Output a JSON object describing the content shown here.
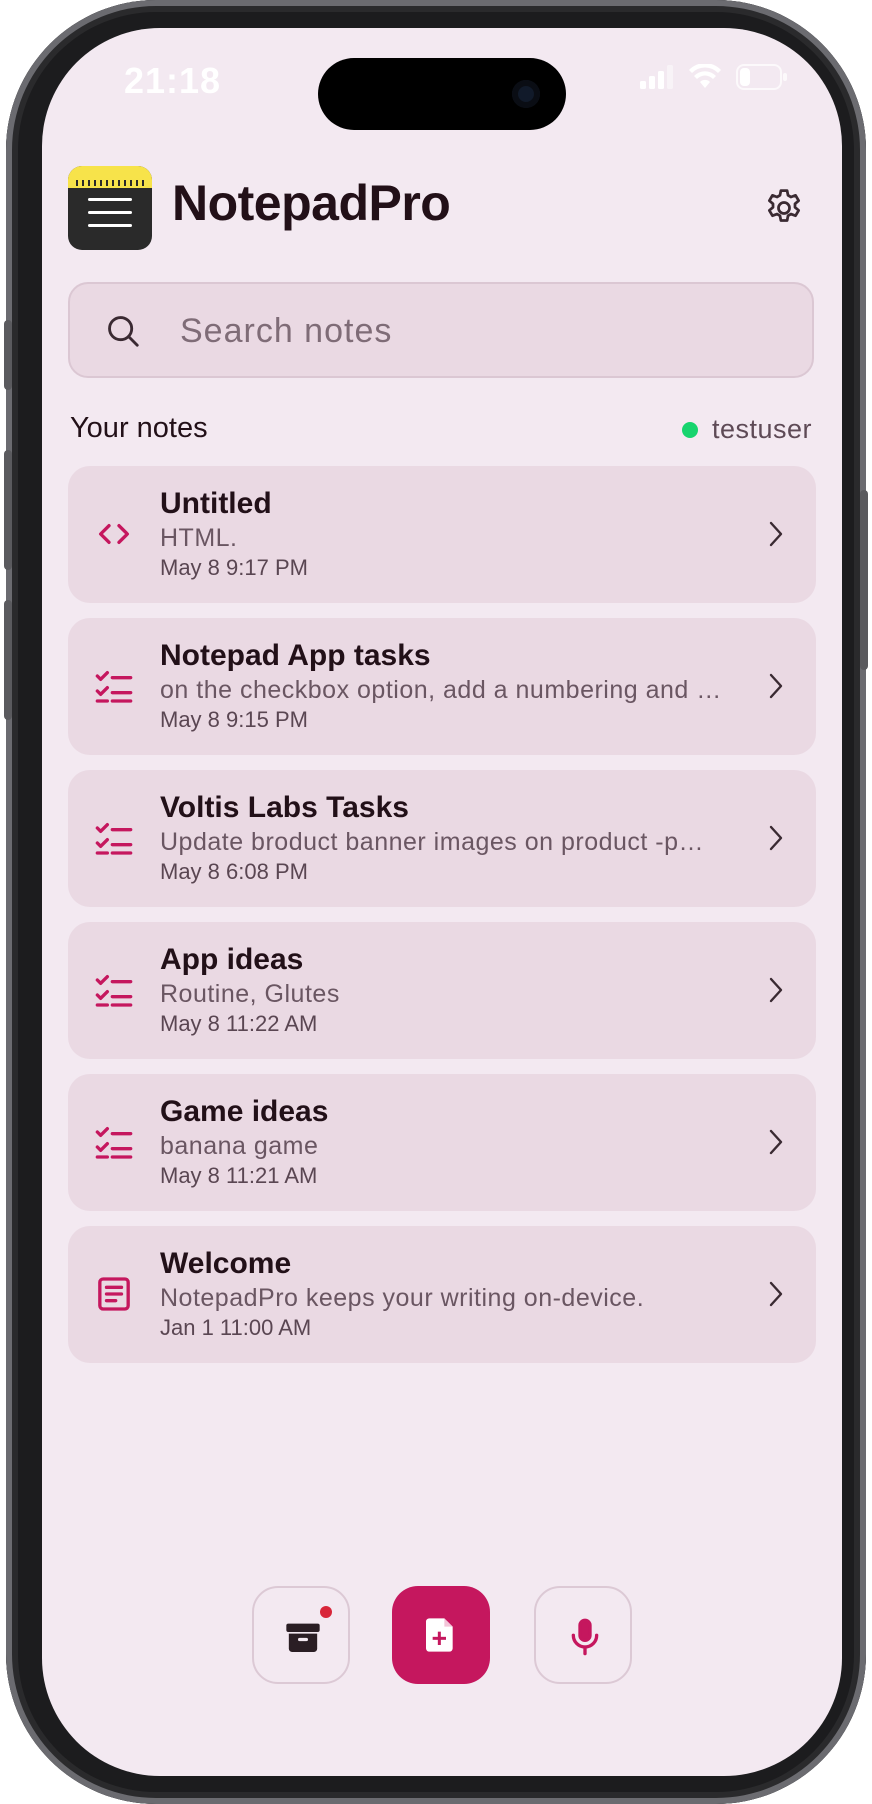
{
  "status_bar": {
    "time": "21:18"
  },
  "app": {
    "title": "NotepadPro"
  },
  "search": {
    "placeholder": "Search notes"
  },
  "section": {
    "title": "Your notes",
    "username": "testuser"
  },
  "notes": [
    {
      "title": "Untitled",
      "preview": "HTML.",
      "date": "May 8 9:17 PM",
      "icon": "code-icon"
    },
    {
      "title": "Notepad App tasks",
      "preview": "on the checkbox option, add a numbering and …",
      "date": "May 8 9:15 PM",
      "icon": "checklist-icon"
    },
    {
      "title": "Voltis Labs Tasks",
      "preview": "Update broduct banner images on product -p…",
      "date": "May 8 6:08 PM",
      "icon": "checklist-icon"
    },
    {
      "title": "App ideas",
      "preview": "Routine, Glutes",
      "date": "May 8 11:22 AM",
      "icon": "checklist-icon"
    },
    {
      "title": "Game ideas",
      "preview": "banana game",
      "date": "May 8 11:21 AM",
      "icon": "checklist-icon"
    },
    {
      "title": "Welcome",
      "preview": "NotepadPro keeps your writing on-device.",
      "date": "Jan 1 11:00 AM",
      "icon": "document-icon"
    }
  ],
  "bottom_bar": {
    "archive_icon": "archive-icon",
    "new_note_icon": "new-document-icon",
    "mic_icon": "microphone-icon"
  },
  "colors": {
    "background": "#f3e9f1",
    "card": "#ead9e3",
    "accent": "#c5175e",
    "online": "#17d46e",
    "logo_yellow": "#f7e34a"
  }
}
